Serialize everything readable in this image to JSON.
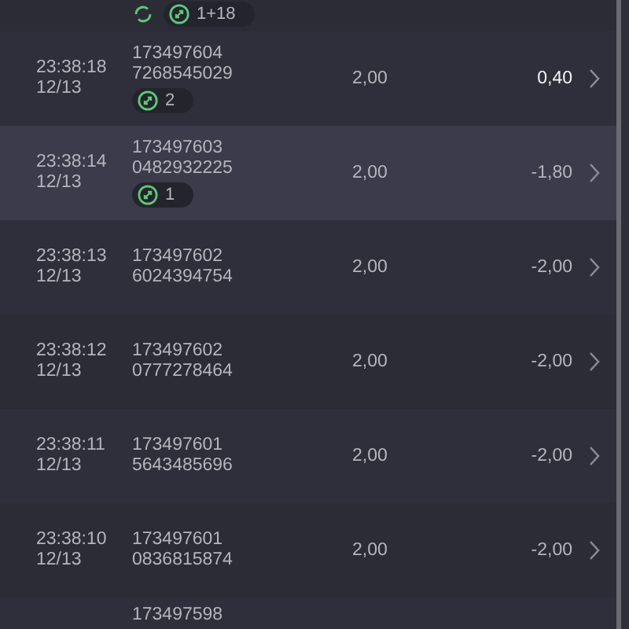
{
  "rows": [
    {
      "kind": "cut_top",
      "refresh": true,
      "badge": "1+18"
    },
    {
      "kind": "bet",
      "time": "23:38:18",
      "date": "12/13",
      "id_line1": "173497604",
      "id_line2": "7268545029",
      "badge": "2",
      "odds": "2,00",
      "result": "0,40",
      "bright": true,
      "highlighted": false
    },
    {
      "kind": "bet",
      "time": "23:38:14",
      "date": "12/13",
      "id_line1": "173497603",
      "id_line2": "0482932225",
      "badge": "1",
      "odds": "2,00",
      "result": "-1,80",
      "bright": false,
      "highlighted": true
    },
    {
      "kind": "bet",
      "time": "23:38:13",
      "date": "12/13",
      "id_line1": "173497602",
      "id_line2": "6024394754",
      "odds": "2,00",
      "result": "-2,00",
      "bright": false,
      "highlighted": false
    },
    {
      "kind": "bet",
      "time": "23:38:12",
      "date": "12/13",
      "id_line1": "173497602",
      "id_line2": "0777278464",
      "odds": "2,00",
      "result": "-2,00",
      "bright": false,
      "highlighted": false
    },
    {
      "kind": "bet",
      "time": "23:38:11",
      "date": "12/13",
      "id_line1": "173497601",
      "id_line2": "5643485696",
      "odds": "2,00",
      "result": "-2,00",
      "bright": false,
      "highlighted": false
    },
    {
      "kind": "bet",
      "time": "23:38:10",
      "date": "12/13",
      "id_line1": "173497601",
      "id_line2": "0836815874",
      "odds": "2,00",
      "result": "-2,00",
      "bright": false,
      "highlighted": false
    },
    {
      "kind": "cut_bottom",
      "id_line1": "173497598"
    }
  ]
}
